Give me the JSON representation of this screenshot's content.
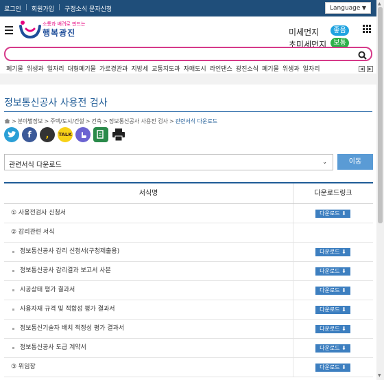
{
  "topbar": {
    "links": [
      "로그인",
      "회원가입",
      "구정소식 문자신청"
    ],
    "language": "Language"
  },
  "header": {
    "logo_small": "소통과 배려로 만드는",
    "logo_main": "행복광진",
    "fine_dust_label": "미세먼지",
    "fine_dust_status": "좋음",
    "ultrafine_dust_label": "초미세먼지",
    "ultrafine_dust_status": "보통"
  },
  "search": {
    "placeholder": ""
  },
  "keywords": [
    "폐기물",
    "위생과",
    "일자리",
    "대형폐기물",
    "가로경관과",
    "지방세",
    "교통지도과",
    "자매도시",
    "라인댄스",
    "광진소식",
    "폐기물",
    "위생과",
    "일자리"
  ],
  "page": {
    "title": "정보통신공사 사용전 검사",
    "breadcrumb": [
      "분야별정보",
      "주택/도시/건설",
      "건축",
      "정보통신공사 사용전 검사",
      "관련서식 다운로드"
    ]
  },
  "sns": [
    "twitter",
    "facebook",
    "kakaostory",
    "kakaotalk",
    "band",
    "url-copy",
    "print"
  ],
  "select": {
    "value": "관련서식 다운로드",
    "go_label": "이동"
  },
  "table": {
    "headers": [
      "서식명",
      "다운로드링크"
    ],
    "download_label": "다운로드",
    "rows": [
      {
        "name": "① 사용전검사 신청서",
        "download": true,
        "sub": false
      },
      {
        "name": "② 감리관련 서식",
        "download": false,
        "sub": false
      },
      {
        "name": "정보통신공사 감리 신청서(구청제출용)",
        "download": true,
        "sub": true
      },
      {
        "name": "정보통신공사 감리결과 보고서 사본",
        "download": true,
        "sub": true
      },
      {
        "name": "시공상태 평가 결과서",
        "download": true,
        "sub": true
      },
      {
        "name": "사용자재 규격 및 적합성 평가 결과서",
        "download": true,
        "sub": true
      },
      {
        "name": "정보통신기술자 배치 적정성 평가 결과서",
        "download": true,
        "sub": true
      },
      {
        "name": "정보통신공사 도급 계약서",
        "download": true,
        "sub": true
      },
      {
        "name": "③ 위임장",
        "download": true,
        "sub": false
      }
    ]
  },
  "colors": {
    "topbar": "#1f4e7a",
    "accent": "#1e5b96",
    "search_border": "#d63a8a",
    "good": "#1fa3e0",
    "normal": "#2db04a"
  }
}
